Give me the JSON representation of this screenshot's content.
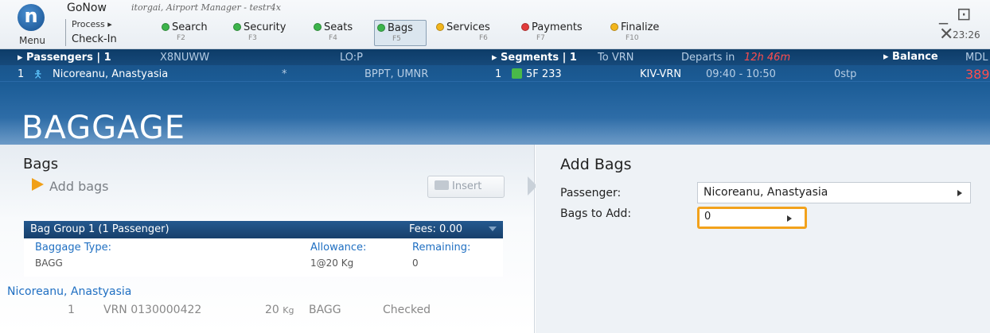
{
  "app": {
    "logo_letter": "n",
    "menu_label": "Menu",
    "title": "GoNow",
    "subtitle": "itorgai, Airport Manager - testr4x",
    "process_label": "Process ▸",
    "process_value": "Check-In",
    "clock": "23:26",
    "window_controls": "_ ⊡ ✕"
  },
  "steps": [
    {
      "label": "Search",
      "key": "F2",
      "color": "#3cb44b"
    },
    {
      "label": "Security",
      "key": "F3",
      "color": "#3cb44b"
    },
    {
      "label": "Seats",
      "key": "F4",
      "color": "#3cb44b"
    },
    {
      "label": "Bags",
      "key": "F5",
      "color": "#3cb44b",
      "active": true
    },
    {
      "label": "Services",
      "key": "F6",
      "color": "#f2b51c"
    },
    {
      "label": "Payments",
      "key": "F7",
      "color": "#e23b3b"
    },
    {
      "label": "Finalize",
      "key": "F10",
      "color": "#f2b51c"
    }
  ],
  "band": {
    "passengers_title": "▸ Passengers | 1",
    "pnr": "X8NUWW",
    "lo": "LO:P",
    "segments_title": "▸ Segments | 1",
    "to": "To VRN",
    "departs_label": "Departs in",
    "departs_value": "12h 46m",
    "balance_title": "▸ Balance",
    "balance_currency": "MDL",
    "pax_index": "1",
    "pax_name": "Nicoreanu, Anastyasia",
    "pax_star": "*",
    "pax_codes": "BPPT, UMNR",
    "seg_index": "1",
    "seg_flight": "5F  233",
    "seg_route": "KIV-VRN",
    "seg_time": "09:40 - 10:50",
    "seg_stops": "0stp",
    "balance_value": "389",
    "section_title": "BAGGAGE"
  },
  "bags_panel": {
    "title": "Bags",
    "add_bags": "Add bags",
    "insert_label": "Insert",
    "group_title": "Bag Group 1 (1 Passenger)",
    "group_fees": "Fees: 0.00",
    "baggage_type_label": "Baggage Type:",
    "allowance_label": "Allowance:",
    "remaining_label": "Remaining:",
    "baggage_type_value": "BAGG",
    "allowance_value": "1@20 Kg",
    "remaining_value": "0",
    "passenger_link": "Nicoreanu, Anastyasia",
    "bag_row": {
      "index": "1",
      "tag": "VRN  0130000422",
      "weight": "20",
      "weight_unit": "Kg",
      "type": "BAGG",
      "status": "Checked"
    }
  },
  "add_panel": {
    "title": "Add Bags",
    "passenger_label": "Passenger:",
    "passenger_value": "Nicoreanu, Anastyasia",
    "bags_to_add_label": "Bags to Add:",
    "bags_to_add_value": "0"
  }
}
